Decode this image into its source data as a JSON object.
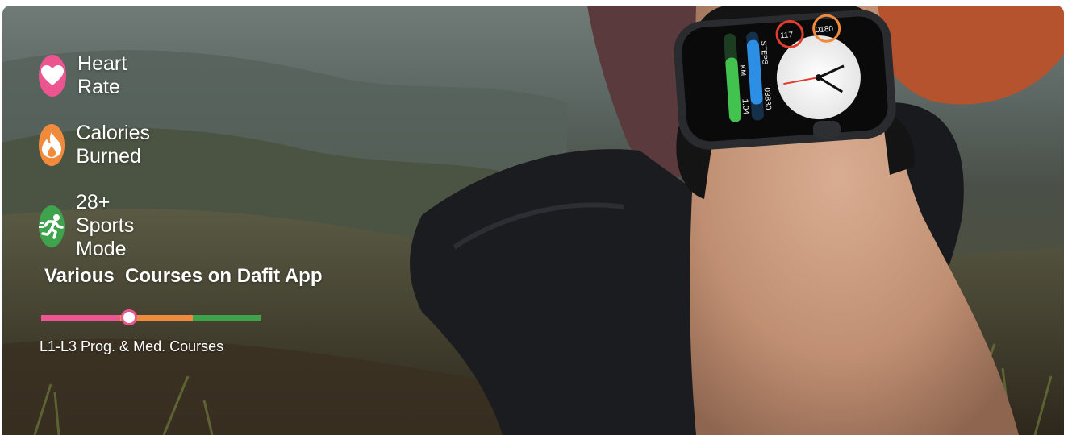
{
  "features": [
    {
      "label": "Heart Rate",
      "icon": "heart-icon",
      "color": "#ec5590"
    },
    {
      "label": "Calories Burned",
      "icon": "flame-icon",
      "color": "#f08a3c"
    },
    {
      "label": "28+ Sports Mode",
      "icon": "runner-icon",
      "color": "#3fa34d"
    }
  ],
  "courses": {
    "title": "Various  Courses on Dafit App",
    "subtitle": "L1-L3 Prog. & Med. Courses",
    "bar_colors": [
      "#ec5590",
      "#f08a3c",
      "#3fa34d"
    ],
    "level": 0.4
  },
  "watch": {
    "distance_label": "KM",
    "distance_value": "1.04",
    "steps_label": "STEPS",
    "steps_value": "03830",
    "heart_value": "117",
    "calories_value": "0180"
  }
}
